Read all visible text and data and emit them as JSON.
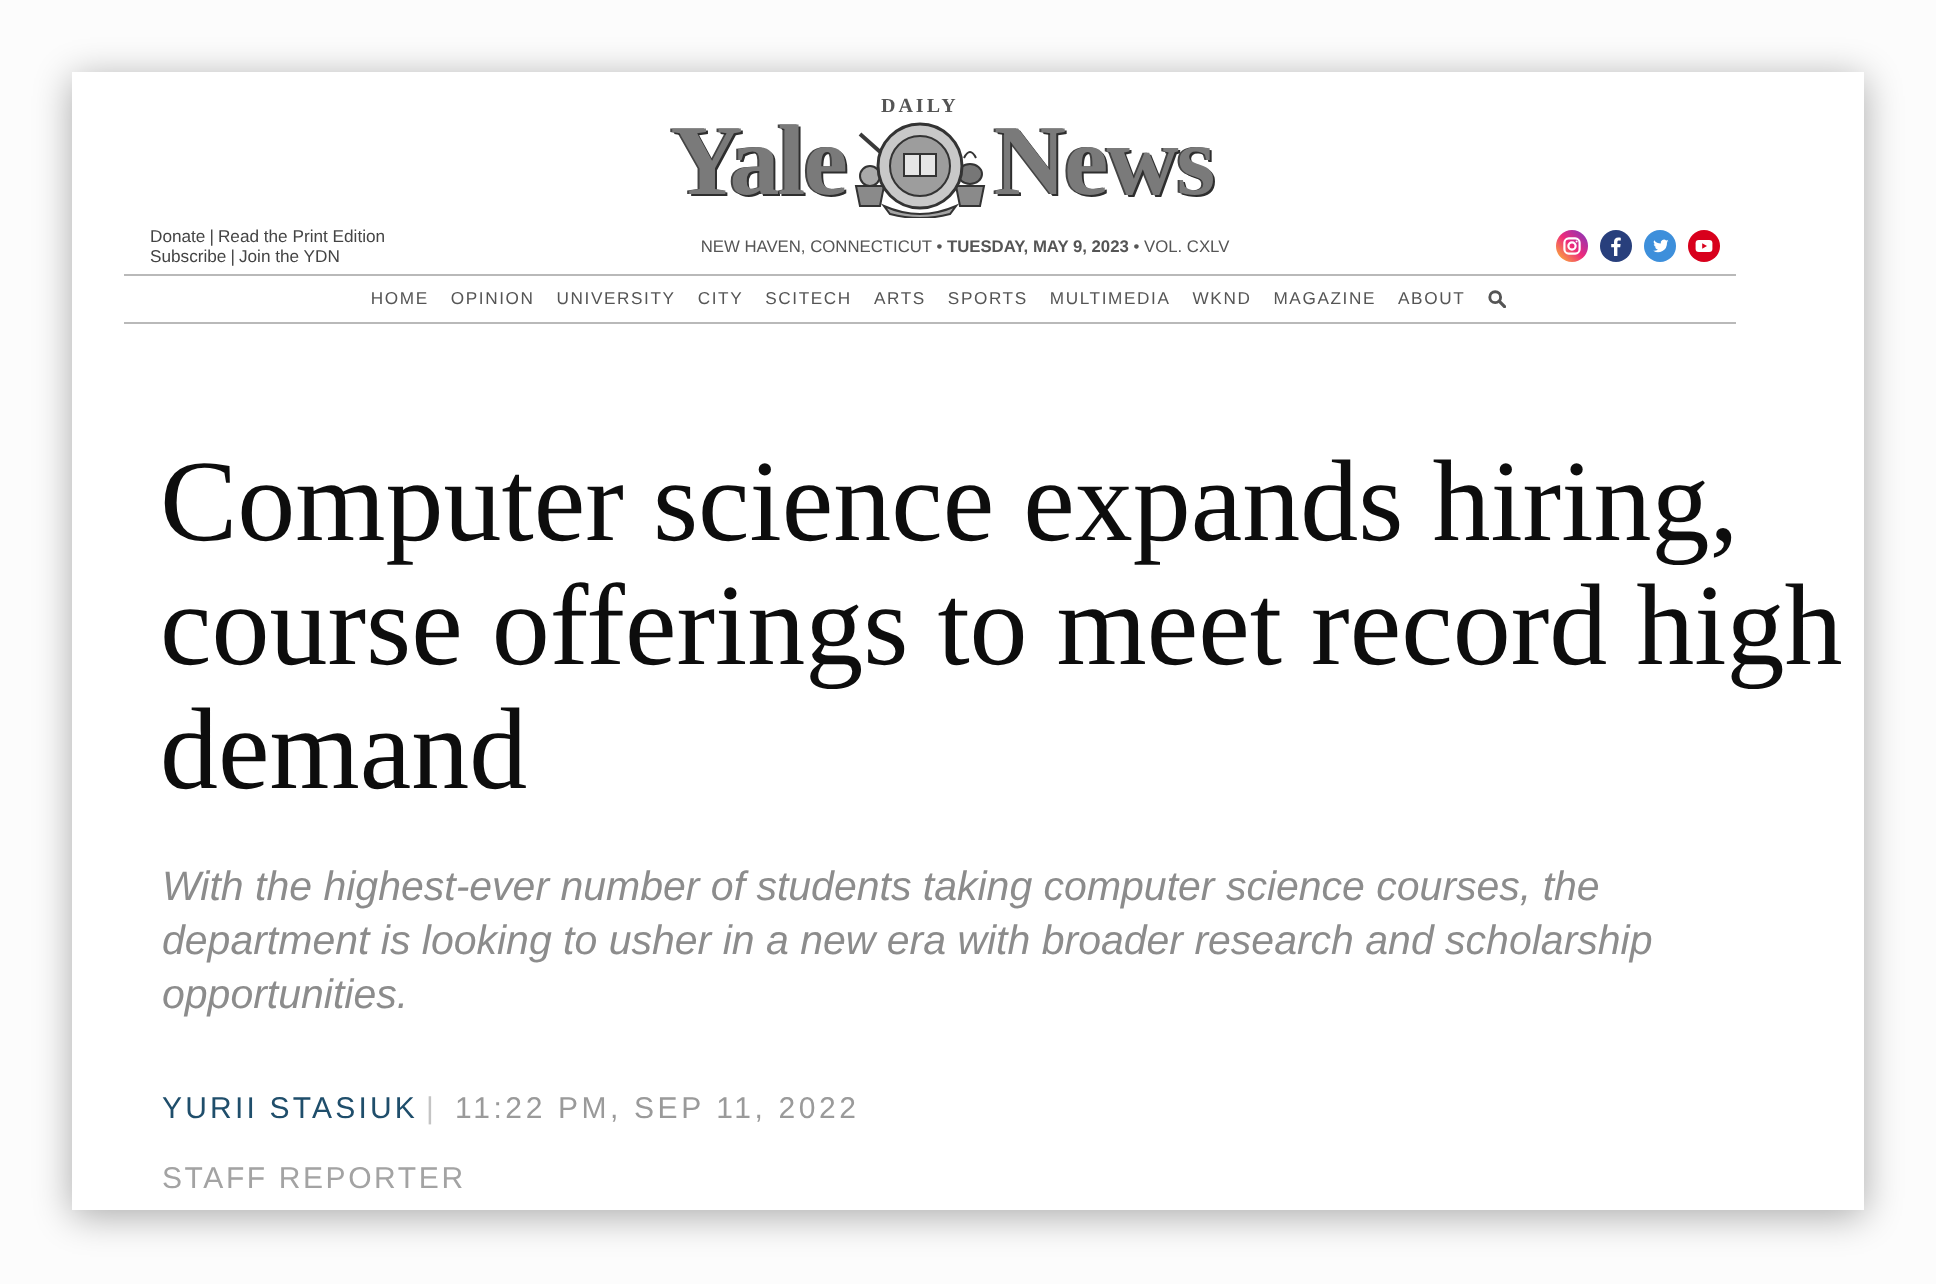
{
  "masthead": {
    "logo": {
      "left_word": "Yale",
      "seal_text": "DAILY",
      "right_word": "News"
    },
    "utility_links": [
      {
        "left": "Donate",
        "separator": "|",
        "right": "Read the Print Edition"
      },
      {
        "left": "Subscribe",
        "separator": "|",
        "right": "Join the YDN"
      }
    ],
    "dateline": "NEW HAVEN, CONNECTICUT • **TUESDAY, MAY 9, 2023** • VOL. CXLV",
    "nav": [
      "HOME",
      "OPINION",
      "UNIVERSITY",
      "CITY",
      "SCITECH",
      "ARTS",
      "SPORTS",
      "MULTIMEDIA",
      "WKND",
      "MAGAZINE",
      "ABOUT"
    ]
  },
  "article": {
    "headline": "Computer science expands hiring, course offerings to meet record high demand",
    "summary": "With the highest-ever number of students taking computer science courses, the department is looking to usher in a new era with broader research and scholarship opportunities.",
    "byline": {
      "author": "YURII STASIUK",
      "separator": "|",
      "published": "11:22 PM, SEP 11, 2022",
      "role": "STAFF REPORTER"
    }
  }
}
